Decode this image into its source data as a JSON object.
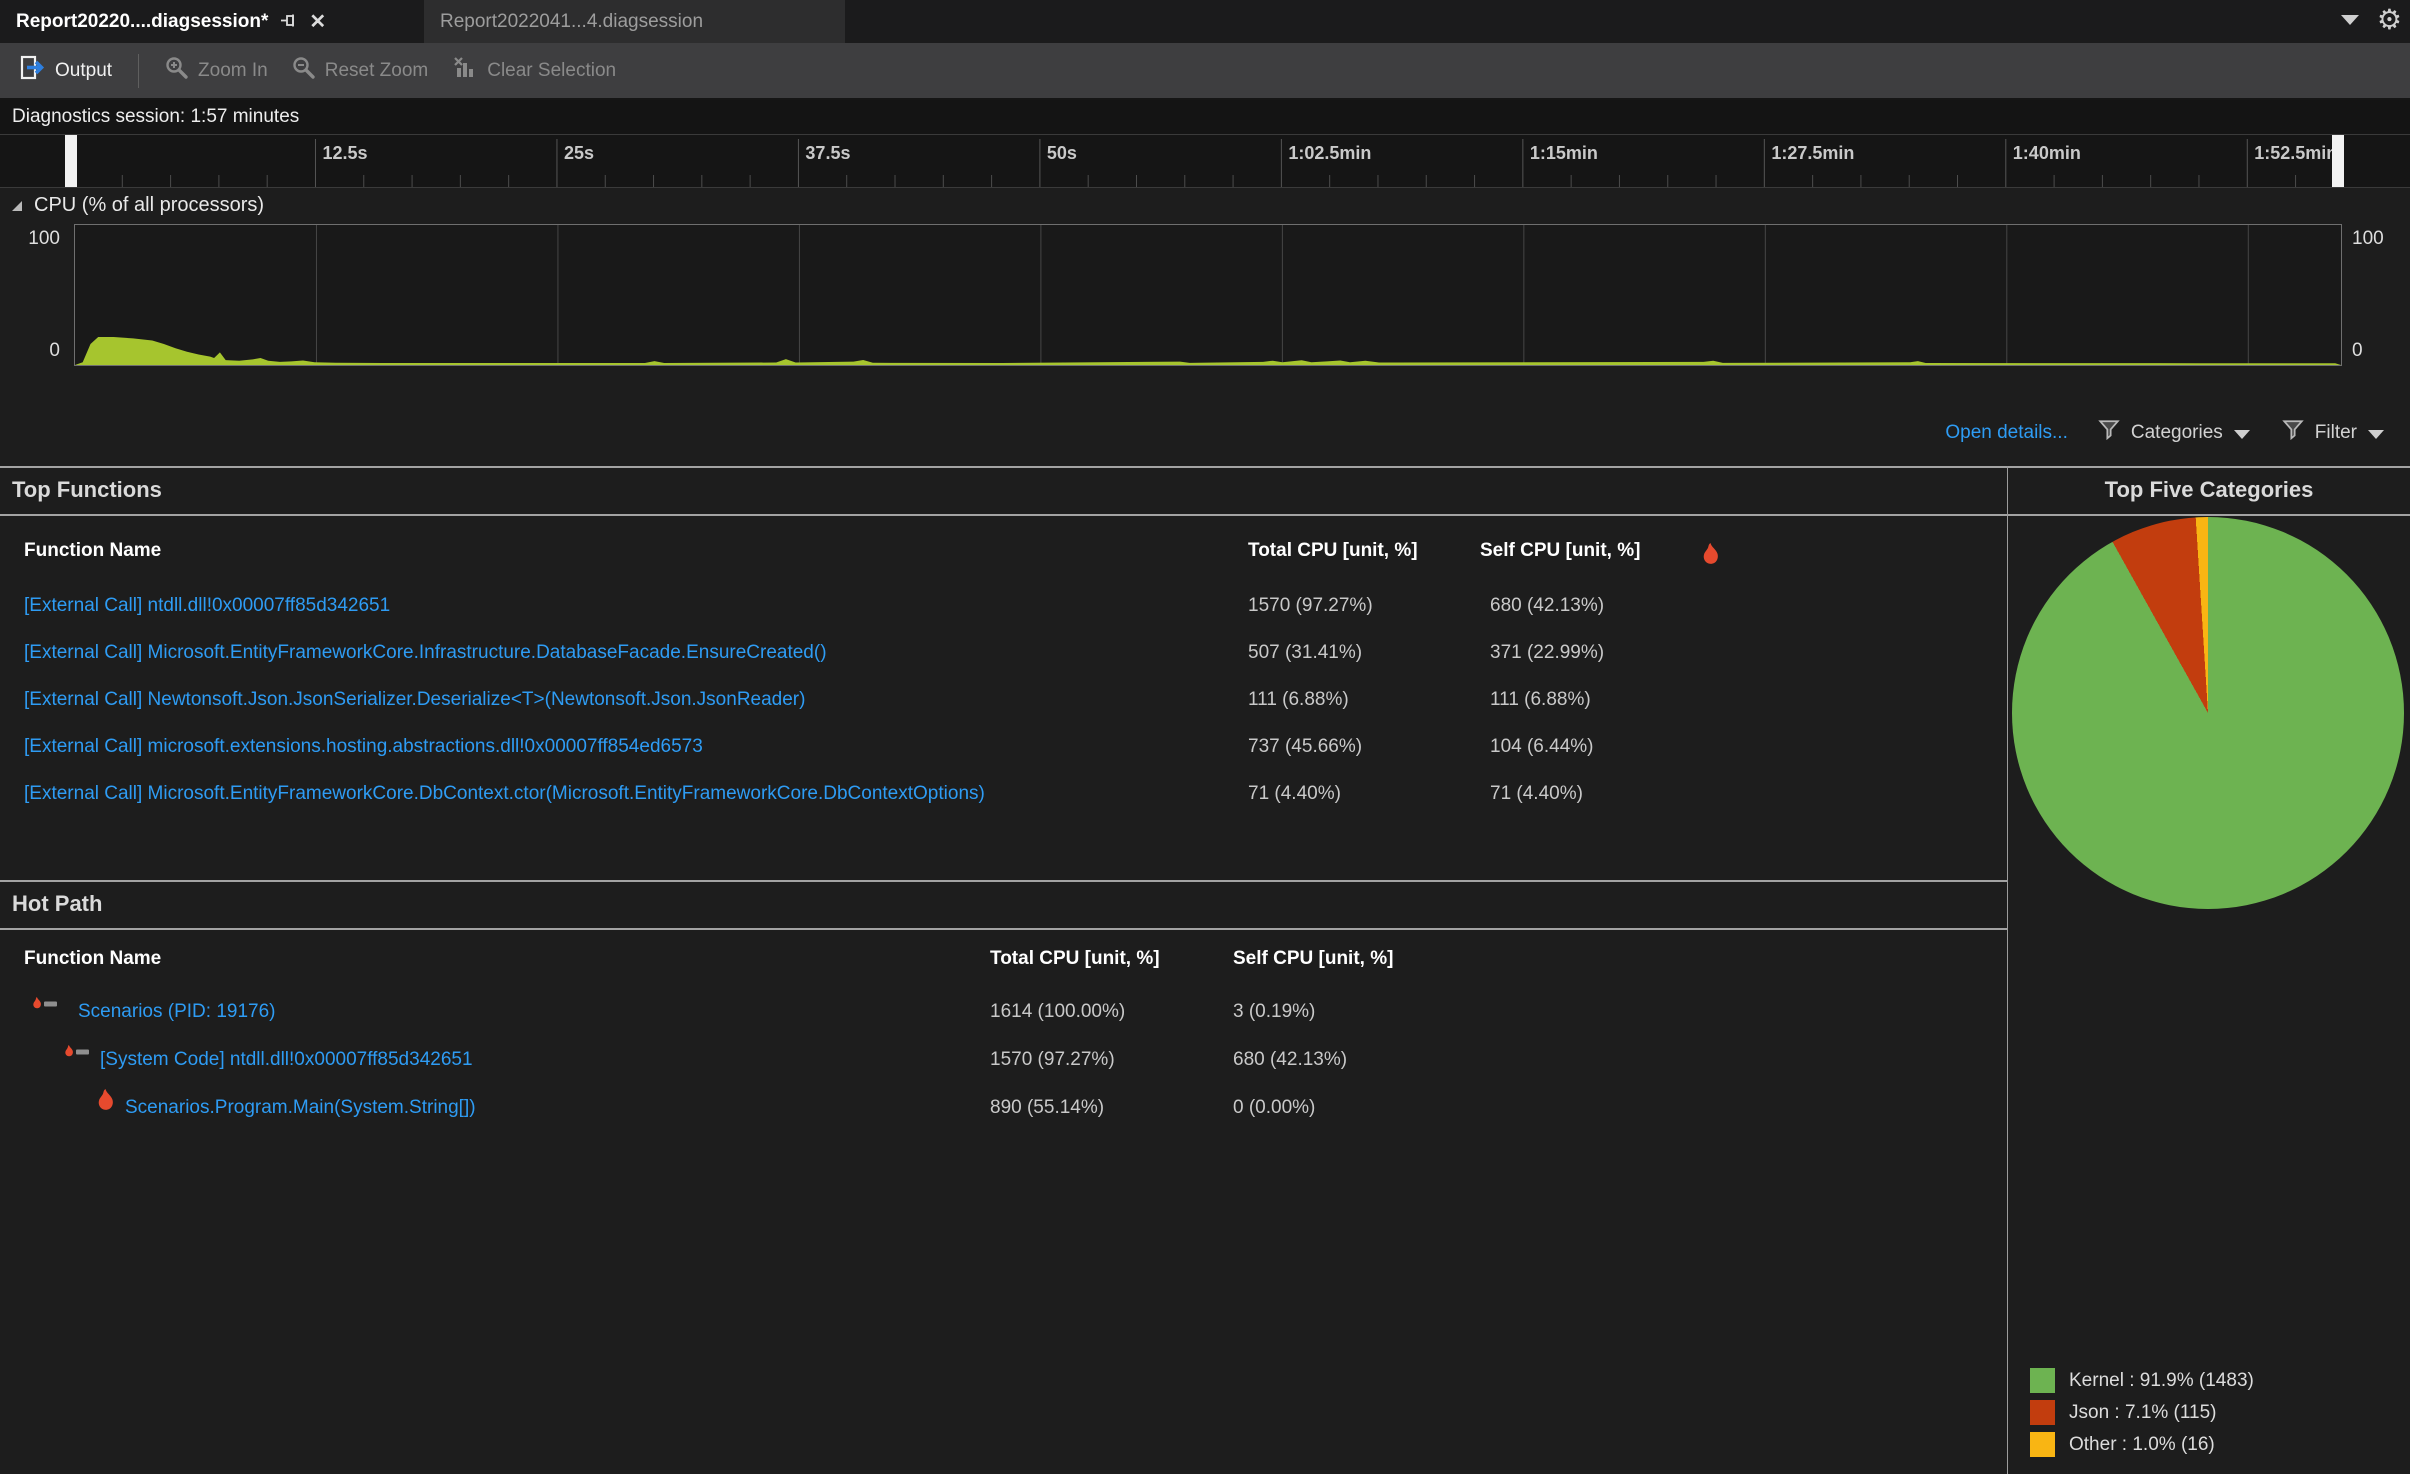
{
  "tabs": {
    "tab1": {
      "label": "Report20220....diagsession*"
    },
    "tab2": {
      "label": "Report2022041...4.diagsession"
    }
  },
  "toolbar": {
    "output": "Output",
    "zoom_in": "Zoom In",
    "reset_zoom": "Reset Zoom",
    "clear_selection": "Clear Selection"
  },
  "session": {
    "label": "Diagnostics session: 1:57 minutes"
  },
  "timeline": {
    "duration_s": 117.3,
    "major_tick_s": 12.5,
    "minor_tick_s": 2.5,
    "labels": [
      {
        "s": 12.5,
        "text": "12.5s"
      },
      {
        "s": 25,
        "text": "25s"
      },
      {
        "s": 37.5,
        "text": "37.5s"
      },
      {
        "s": 50,
        "text": "50s"
      },
      {
        "s": 62.5,
        "text": "1:02.5min"
      },
      {
        "s": 75,
        "text": "1:15min"
      },
      {
        "s": 87.5,
        "text": "1:27.5min"
      },
      {
        "s": 100,
        "text": "1:40min"
      },
      {
        "s": 112.5,
        "text": "1:52.5min"
      }
    ],
    "selection": {
      "start_s": 0,
      "end_s": 117
    }
  },
  "cpu_chart": {
    "title": "CPU (% of all processors)",
    "y_label_top": "100",
    "y_label_bottom": "0",
    "series_color": "#a6c52e",
    "chart_data": {
      "type": "area",
      "xlabel": "time (s)",
      "ylabel": "% of all processors",
      "ylim": [
        0,
        100
      ],
      "points": [
        [
          0,
          0
        ],
        [
          0.4,
          2
        ],
        [
          0.8,
          15
        ],
        [
          1.2,
          20
        ],
        [
          2,
          20
        ],
        [
          3,
          19
        ],
        [
          4,
          17.5
        ],
        [
          4.6,
          15
        ],
        [
          5.2,
          12
        ],
        [
          5.8,
          9.5
        ],
        [
          6.4,
          7.5
        ],
        [
          7,
          6
        ],
        [
          7.2,
          5
        ],
        [
          7.5,
          9
        ],
        [
          7.8,
          3.5
        ],
        [
          8.5,
          3
        ],
        [
          9.2,
          4
        ],
        [
          9.6,
          5
        ],
        [
          10,
          3
        ],
        [
          10.6,
          2.2
        ],
        [
          11.2,
          2.6
        ],
        [
          11.8,
          3.2
        ],
        [
          12.4,
          2
        ],
        [
          13.5,
          1.6
        ],
        [
          16,
          1.4
        ],
        [
          29.5,
          1.4
        ],
        [
          30,
          2.8
        ],
        [
          30.5,
          1.4
        ],
        [
          36.3,
          1.8
        ],
        [
          36.8,
          4.2
        ],
        [
          37.3,
          1.8
        ],
        [
          40.3,
          2.4
        ],
        [
          40.8,
          3.6
        ],
        [
          41.3,
          1.6
        ],
        [
          48,
          1.4
        ],
        [
          57.2,
          2.4
        ],
        [
          57.7,
          1.5
        ],
        [
          61.5,
          2.2
        ],
        [
          62,
          3.1
        ],
        [
          62.5,
          2
        ],
        [
          63.5,
          3.4
        ],
        [
          64,
          2
        ],
        [
          64.8,
          2.6
        ],
        [
          65.5,
          3.2
        ],
        [
          66,
          2
        ],
        [
          66.8,
          3
        ],
        [
          67.5,
          1.8
        ],
        [
          84.3,
          2.2
        ],
        [
          84.8,
          3
        ],
        [
          85.3,
          1.5
        ],
        [
          95,
          2
        ],
        [
          95.4,
          2.8
        ],
        [
          95.8,
          1.4
        ],
        [
          110,
          1.3
        ],
        [
          117,
          1.3
        ]
      ]
    }
  },
  "details_bar": {
    "open_details": "Open details...",
    "categories": "Categories",
    "filter": "Filter"
  },
  "top_functions": {
    "title": "Top Functions",
    "col_name": "Function Name",
    "col_total": "Total CPU [unit, %]",
    "col_self": "Self CPU [unit, %]",
    "rows": [
      {
        "name": "[External Call] ntdll.dll!0x00007ff85d342651",
        "total": "1570 (97.27%)",
        "self": "680 (42.13%)"
      },
      {
        "name": "[External Call] Microsoft.EntityFrameworkCore.Infrastructure.DatabaseFacade.EnsureCreated()",
        "total": "507 (31.41%)",
        "self": "371 (22.99%)"
      },
      {
        "name": "[External Call] Newtonsoft.Json.JsonSerializer.Deserialize<T>(Newtonsoft.Json.JsonReader)",
        "total": "111 (6.88%)",
        "self": "111 (6.88%)"
      },
      {
        "name": "[External Call] microsoft.extensions.hosting.abstractions.dll!0x00007ff854ed6573",
        "total": "737 (45.66%)",
        "self": "104 (6.44%)"
      },
      {
        "name": "[External Call] Microsoft.EntityFrameworkCore.DbContext.ctor(Microsoft.EntityFrameworkCore.DbContextOptions)",
        "total": "71 (4.40%)",
        "self": "71 (4.40%)"
      }
    ]
  },
  "hot_path": {
    "title": "Hot Path",
    "col_name": "Function Name",
    "col_total": "Total CPU [unit, %]",
    "col_self": "Self CPU [unit, %]",
    "rows": [
      {
        "name": "Scenarios (PID: 19176)",
        "total": "1614 (100.00%)",
        "self": "3 (0.19%)",
        "indent": 0,
        "icon": "flame-bar"
      },
      {
        "name": "[System Code] ntdll.dll!0x00007ff85d342651",
        "total": "1570 (97.27%)",
        "self": "680 (42.13%)",
        "indent": 1,
        "icon": "flame-bar"
      },
      {
        "name": "Scenarios.Program.Main(System.String[])",
        "total": "890 (55.14%)",
        "self": "0 (0.00%)",
        "indent": 2,
        "icon": "flame"
      }
    ]
  },
  "top_categories": {
    "title": "Top Five Categories",
    "chart_data": {
      "type": "pie",
      "slices": [
        {
          "label": "Kernel",
          "percent": 91.9,
          "count": 1483,
          "color": "#6db351",
          "legend": "Kernel : 91.9% (1483)"
        },
        {
          "label": "Json",
          "percent": 7.1,
          "count": 115,
          "color": "#c23d0e",
          "legend": "Json : 7.1% (115)"
        },
        {
          "label": "Other",
          "percent": 1.0,
          "count": 16,
          "color": "#f9b513",
          "legend": "Other : 1.0% (16)"
        }
      ]
    }
  }
}
